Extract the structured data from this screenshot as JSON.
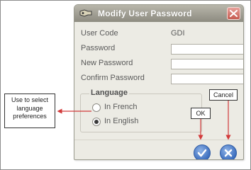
{
  "window": {
    "title": "Modify  User Password",
    "close_icon": "close-icon"
  },
  "form": {
    "user_code_label": "User Code",
    "user_code_value": "GDI",
    "password_label": "Password",
    "password_value": "",
    "new_password_label": "New Password",
    "new_password_value": "",
    "confirm_password_label": "Confirm Password",
    "confirm_password_value": ""
  },
  "language": {
    "group_label": "Language",
    "options": [
      {
        "label": "In French",
        "selected": false
      },
      {
        "label": "In English",
        "selected": true
      }
    ]
  },
  "buttons": {
    "ok_icon": "checkmark-icon",
    "cancel_icon": "x-icon"
  },
  "annotations": {
    "language_note_lines": [
      "Use to select",
      "language",
      "preferences"
    ],
    "ok_label": "OK",
    "cancel_label": "Cancel"
  },
  "colors": {
    "titlebar": "#a3a196",
    "dialog_bg": "#ecebe4",
    "button_blue": "#3d6fbf",
    "close_red": "#c55a4f",
    "arrow_red": "#d23a3a"
  }
}
